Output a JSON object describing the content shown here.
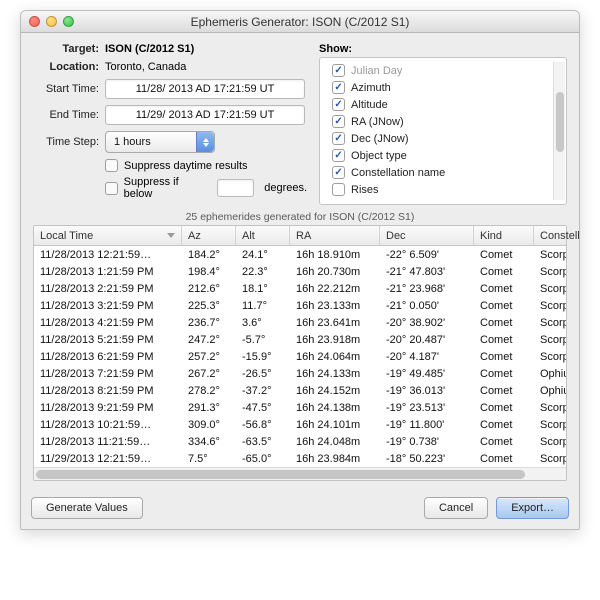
{
  "window": {
    "title": "Ephemeris Generator: ISON (C/2012 S1)"
  },
  "form": {
    "target_label": "Target:",
    "target_value": "ISON (C/2012 S1)",
    "location_label": "Location:",
    "location_value": "Toronto, Canada",
    "start_label": "Start Time:",
    "start_value": "11/28/  2013 AD  17:21:59  UT",
    "end_label": "End Time:",
    "end_value": "11/29/  2013 AD  17:21:59  UT",
    "step_label": "Time Step:",
    "step_value": "1 hours",
    "suppress_daytime": "Suppress daytime results",
    "suppress_below_pre": "Suppress if below",
    "suppress_below_post": "degrees."
  },
  "show": {
    "label": "Show:",
    "items": [
      {
        "label": "Julian Day",
        "checked": true,
        "faded": true
      },
      {
        "label": "Azimuth",
        "checked": true
      },
      {
        "label": "Altitude",
        "checked": true
      },
      {
        "label": "RA (JNow)",
        "checked": true
      },
      {
        "label": "Dec (JNow)",
        "checked": true
      },
      {
        "label": "Object type",
        "checked": true
      },
      {
        "label": "Constellation name",
        "checked": true
      },
      {
        "label": "Rises",
        "checked": false
      }
    ]
  },
  "status": "25 ephemerides generated for ISON (C/2012 S1)",
  "table": {
    "columns": [
      "Local Time",
      "Az",
      "Alt",
      "RA",
      "Dec",
      "Kind",
      "Constellat"
    ],
    "rows": [
      [
        "11/28/2013 12:21:59…",
        "184.2°",
        "24.1°",
        "16h 18.910m",
        "-22° 6.509'",
        "Comet",
        "Scorpi"
      ],
      [
        "11/28/2013 1:21:59 PM",
        "198.4°",
        "22.3°",
        "16h 20.730m",
        "-21° 47.803'",
        "Comet",
        "Scorpi"
      ],
      [
        "11/28/2013 2:21:59 PM",
        "212.6°",
        "18.1°",
        "16h 22.212m",
        "-21° 23.968'",
        "Comet",
        "Scorpi"
      ],
      [
        "11/28/2013 3:21:59 PM",
        "225.3°",
        "11.7°",
        "16h 23.133m",
        "-21° 0.050'",
        "Comet",
        "Scorpi"
      ],
      [
        "11/28/2013 4:21:59 PM",
        "236.7°",
        "3.6°",
        "16h 23.641m",
        "-20° 38.902'",
        "Comet",
        "Scorpi"
      ],
      [
        "11/28/2013 5:21:59 PM",
        "247.2°",
        "-5.7°",
        "16h 23.918m",
        "-20° 20.487'",
        "Comet",
        "Scorpi"
      ],
      [
        "11/28/2013 6:21:59 PM",
        "257.2°",
        "-15.9°",
        "16h 24.064m",
        "-20° 4.187'",
        "Comet",
        "Scorpi"
      ],
      [
        "11/28/2013 7:21:59 PM",
        "267.2°",
        "-26.5°",
        "16h 24.133m",
        "-19° 49.485'",
        "Comet",
        "Ophiu"
      ],
      [
        "11/28/2013 8:21:59 PM",
        "278.2°",
        "-37.2°",
        "16h 24.152m",
        "-19° 36.013'",
        "Comet",
        "Ophiu"
      ],
      [
        "11/28/2013 9:21:59 PM",
        "291.3°",
        "-47.5°",
        "16h 24.138m",
        "-19° 23.513'",
        "Comet",
        "Scorpi"
      ],
      [
        "11/28/2013 10:21:59…",
        "309.0°",
        "-56.8°",
        "16h 24.101m",
        "-19° 11.800'",
        "Comet",
        "Scorpi"
      ],
      [
        "11/28/2013 11:21:59…",
        "334.6°",
        "-63.5°",
        "16h 24.048m",
        "-19° 0.738'",
        "Comet",
        "Scorpi"
      ],
      [
        "11/29/2013 12:21:59…",
        "7.5°",
        "-65.0°",
        "16h 23.984m",
        "-18° 50.223'",
        "Comet",
        "Scorpi"
      ]
    ]
  },
  "buttons": {
    "generate": "Generate Values",
    "cancel": "Cancel",
    "export": "Export…"
  }
}
